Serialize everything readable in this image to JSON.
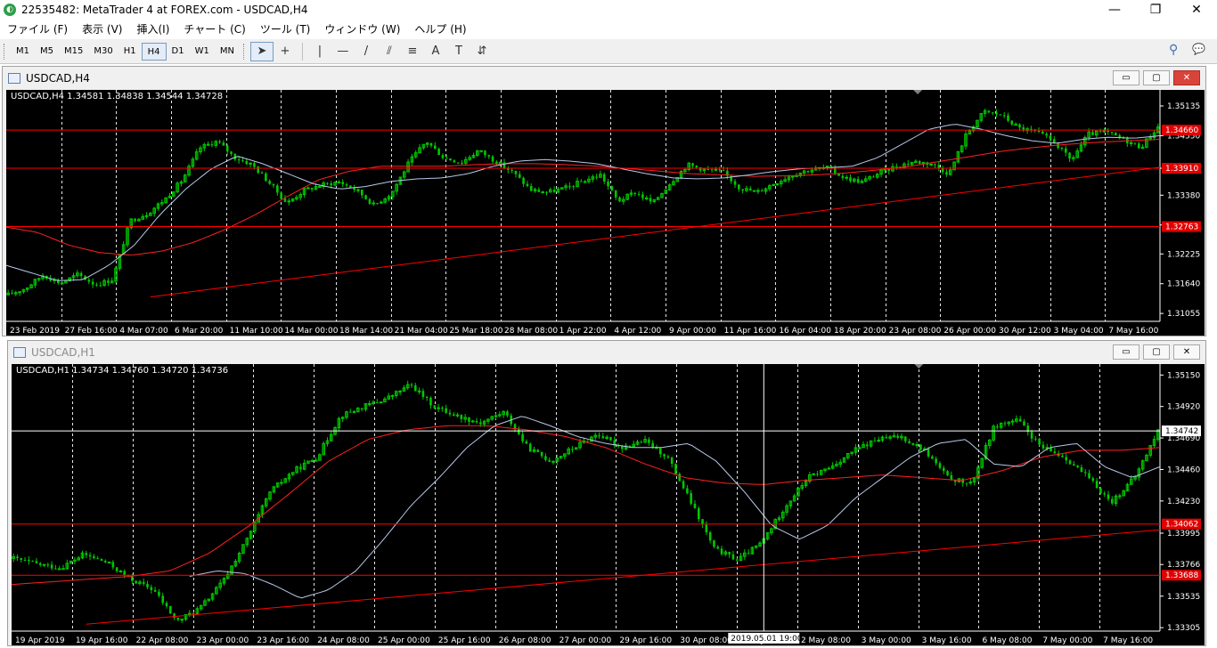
{
  "window": {
    "title": "22535482: MetaTrader 4 at FOREX.com - USDCAD,H4",
    "minimize": "—",
    "maximize": "❐",
    "close": "✕"
  },
  "menu": [
    {
      "label": "ファイル (F)"
    },
    {
      "label": "表示 (V)"
    },
    {
      "label": "挿入(I)"
    },
    {
      "label": "チャート (C)"
    },
    {
      "label": "ツール (T)"
    },
    {
      "label": "ウィンドウ (W)"
    },
    {
      "label": "ヘルプ (H)"
    }
  ],
  "toolbar": {
    "timeframes": [
      "M1",
      "M5",
      "M15",
      "M30",
      "H1",
      "H4",
      "D1",
      "W1",
      "MN"
    ],
    "active_timeframe": "H4",
    "tools": [
      {
        "name": "cursor-icon",
        "glyph": "➤"
      },
      {
        "name": "crosshair-icon",
        "glyph": "+"
      },
      {
        "name": "vertical-line-icon",
        "glyph": "|"
      },
      {
        "name": "horizontal-line-icon",
        "glyph": "—"
      },
      {
        "name": "trendline-icon",
        "glyph": "/"
      },
      {
        "name": "channel-icon",
        "glyph": "⫽"
      },
      {
        "name": "fibonacci-icon",
        "glyph": "≡"
      },
      {
        "name": "text-icon",
        "glyph": "A"
      },
      {
        "name": "text-label-icon",
        "glyph": "T"
      },
      {
        "name": "arrows-icon",
        "glyph": "⇵"
      }
    ],
    "search_glyph": "⚲",
    "chat_glyph": "💬"
  },
  "colors": {
    "bull": "#00c800",
    "ma_fast": "#b8c8e8",
    "ma_slow": "#ff2020",
    "level": "#ff0000",
    "grid": "#ffffff",
    "price_line": "#ffffff"
  },
  "chart_data": [
    {
      "type": "candlestick",
      "title": "USDCAD,H4",
      "info": "USDCAD,H4  1.34581 1.34838 1.34544 1.34728",
      "ylim": [
        1.309,
        1.3545
      ],
      "price_ticks": [
        "1.35135",
        "1.34550",
        "1.33910",
        "1.33380",
        "1.32795",
        "1.32225",
        "1.31640",
        "1.31055"
      ],
      "price_tick_values": [
        1.35135,
        1.3455,
        1.3391,
        1.3338,
        1.32795,
        1.32225,
        1.3164,
        1.31055
      ],
      "highlighted_labels": [
        {
          "text": "1.34660",
          "value": 1.3466
        },
        {
          "text": "1.33910",
          "value": 1.3391
        },
        {
          "text": "1.32763",
          "value": 1.32763
        }
      ],
      "x_labels": [
        "23 Feb 2019",
        "27 Feb 16:00",
        "4 Mar 07:00",
        "6 Mar 20:00",
        "11 Mar 10:00",
        "14 Mar 00:00",
        "18 Mar 14:00",
        "21 Mar 04:00",
        "25 Mar 18:00",
        "28 Mar 08:00",
        "1 Apr 22:00",
        "4 Apr 12:00",
        "9 Apr 00:00",
        "11 Apr 16:00",
        "16 Apr 04:00",
        "18 Apr 20:00",
        "23 Apr 08:00",
        "26 Apr 00:00",
        "30 Apr 12:00",
        "3 May 04:00",
        "7 May 16:00"
      ],
      "price_series": [
        1.3142,
        1.3155,
        1.3181,
        1.3165,
        1.3182,
        1.3162,
        1.3172,
        1.3288,
        1.3302,
        1.333,
        1.3368,
        1.3431,
        1.3444,
        1.3412,
        1.3398,
        1.3362,
        1.3322,
        1.3348,
        1.3358,
        1.3364,
        1.3348,
        1.3318,
        1.3342,
        1.3402,
        1.3444,
        1.3412,
        1.3402,
        1.3426,
        1.3404,
        1.3382,
        1.3348,
        1.3344,
        1.3352,
        1.3366,
        1.3378,
        1.3326,
        1.3344,
        1.3322,
        1.3362,
        1.3398,
        1.3388,
        1.3384,
        1.3352,
        1.3344,
        1.3362,
        1.3378,
        1.3388,
        1.3392,
        1.3372,
        1.3364,
        1.3382,
        1.3395,
        1.3404,
        1.34,
        1.338,
        1.3458,
        1.3502,
        1.3496,
        1.347,
        1.3462,
        1.3444,
        1.3406,
        1.3458,
        1.3462,
        1.3448,
        1.3432,
        1.3472
      ],
      "ma_fast_series": [
        1.32,
        1.3185,
        1.317,
        1.3172,
        1.32,
        1.324,
        1.33,
        1.335,
        1.339,
        1.3415,
        1.34,
        1.338,
        1.336,
        1.335,
        1.3355,
        1.3365,
        1.337,
        1.3372,
        1.338,
        1.3395,
        1.3405,
        1.3408,
        1.3405,
        1.34,
        1.339,
        1.338,
        1.3372,
        1.337,
        1.3372,
        1.3378,
        1.3385,
        1.339,
        1.3392,
        1.3395,
        1.3412,
        1.344,
        1.3468,
        1.3478,
        1.3468,
        1.3455,
        1.3445,
        1.344,
        1.3448,
        1.3452,
        1.345,
        1.3455
      ],
      "ma_slow_series": [
        1.3275,
        1.3265,
        1.324,
        1.3225,
        1.322,
        1.3228,
        1.3245,
        1.327,
        1.33,
        1.3335,
        1.3368,
        1.3385,
        1.3395,
        1.3395,
        1.3395,
        1.3398,
        1.34,
        1.34,
        1.3398,
        1.3395,
        1.339,
        1.3385,
        1.338,
        1.3378,
        1.3375,
        1.3376,
        1.3378,
        1.3382,
        1.3388,
        1.3395,
        1.3405,
        1.3415,
        1.3425,
        1.3432,
        1.3438,
        1.3442,
        1.3445,
        1.3448
      ],
      "trendline": [
        [
          0.125,
          1.3138
        ],
        [
          1.0,
          1.3393
        ]
      ],
      "levels": [
        1.3466,
        1.3391,
        1.32763
      ],
      "current_price": 1.3466
    },
    {
      "type": "candlestick",
      "title": "USDCAD,H1",
      "info": "USDCAD,H1  1.34734 1.34760 1.34720 1.34736",
      "ylim": [
        1.3328,
        1.3523
      ],
      "price_ticks": [
        "1.35150",
        "1.34920",
        "1.34690",
        "1.34460",
        "1.34230",
        "1.33995",
        "1.33766",
        "1.33535",
        "1.33305"
      ],
      "price_tick_values": [
        1.3515,
        1.3492,
        1.3469,
        1.3446,
        1.3423,
        1.33995,
        1.33766,
        1.33535,
        1.33305
      ],
      "highlighted_labels": [
        {
          "text": "1.34742",
          "value": 1.34742,
          "style": "white"
        },
        {
          "text": "1.34062",
          "value": 1.34062,
          "style": "red"
        },
        {
          "text": "1.33688",
          "value": 1.33688,
          "style": "red"
        }
      ],
      "x_labels": [
        "19 Apr 2019",
        "19 Apr 16:00",
        "22 Apr 08:00",
        "23 Apr 00:00",
        "23 Apr 16:00",
        "24 Apr 08:00",
        "25 Apr 00:00",
        "25 Apr 16:00",
        "26 Apr 08:00",
        "27 Apr 00:00",
        "29 Apr 16:00",
        "30 Apr 08:00",
        "1 May 0",
        "2 May 08:00",
        "3 May 00:00",
        "3 May 16:00",
        "6 May 08:00",
        "7 May 00:00",
        "7 May 16:00"
      ],
      "crosshair_label": "2019.05.01 19:00",
      "price_series": [
        1.3381,
        1.3377,
        1.3374,
        1.3384,
        1.3378,
        1.3366,
        1.3358,
        1.3335,
        1.3345,
        1.3365,
        1.3395,
        1.343,
        1.3445,
        1.3455,
        1.3485,
        1.3492,
        1.3498,
        1.3508,
        1.3492,
        1.3485,
        1.348,
        1.3488,
        1.3462,
        1.3452,
        1.3462,
        1.3472,
        1.3462,
        1.3467,
        1.3455,
        1.3422,
        1.3388,
        1.338,
        1.3392,
        1.3418,
        1.344,
        1.3448,
        1.346,
        1.3468,
        1.347,
        1.346,
        1.344,
        1.3435,
        1.3478,
        1.3482,
        1.3462,
        1.3455,
        1.344,
        1.3422,
        1.344,
        1.3474
      ],
      "ma_fast_series": [
        1.3368,
        1.3372,
        1.337,
        1.3362,
        1.3352,
        1.3358,
        1.3372,
        1.3395,
        1.342,
        1.344,
        1.3462,
        1.3478,
        1.3485,
        1.3478,
        1.347,
        1.3465,
        1.3462,
        1.3462,
        1.3465,
        1.3452,
        1.343,
        1.3405,
        1.3395,
        1.3405,
        1.3425,
        1.344,
        1.3455,
        1.3465,
        1.3468,
        1.345,
        1.3448,
        1.3462,
        1.3465,
        1.3448,
        1.344,
        1.3448
      ],
      "ma_slow_series": [
        1.3362,
        1.3364,
        1.3366,
        1.3368,
        1.3372,
        1.3385,
        1.3405,
        1.3428,
        1.3452,
        1.3468,
        1.3475,
        1.3478,
        1.3478,
        1.3475,
        1.347,
        1.3462,
        1.345,
        1.344,
        1.3436,
        1.3435,
        1.3438,
        1.344,
        1.3442,
        1.344,
        1.3438,
        1.3445,
        1.3455,
        1.346,
        1.346,
        1.3462
      ],
      "trendline": [
        [
          0.065,
          1.3333
        ],
        [
          1.0,
          1.3402
        ]
      ],
      "levels": [
        1.34062,
        1.33688
      ],
      "current_price": 1.34742,
      "crosshair_x_fraction": 0.655
    }
  ]
}
